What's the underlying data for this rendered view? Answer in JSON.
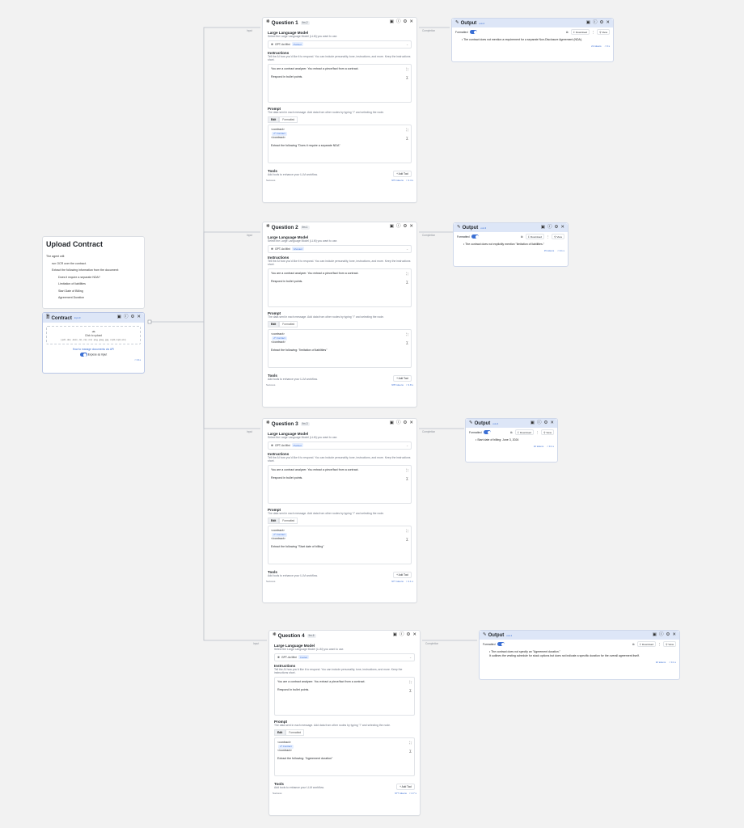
{
  "upload_card": {
    "title": "Upload Contract",
    "intro": "The agent will:",
    "steps": [
      "run OCR over the contract.",
      "Extract the following information from the document:"
    ],
    "sub_steps": [
      "Does it require a separate NDA?",
      "Limitation of liabilities",
      "Start Date of Billing",
      "Agreement Duration"
    ]
  },
  "contract_node": {
    "title": "Contract",
    "id": "inpt-0",
    "upload_label": "Click to upload",
    "file_types": "(.pdf, .doc, .docx, .txt, .csv, .md, .png, .jpeg, .jpg, .mp3, mp4, etc.)",
    "api_link": "How to manage documents via API",
    "expose_label": "Expose as input",
    "footer": "< 0.1s"
  },
  "questions": [
    {
      "title": "Question 1",
      "id": "llm-2",
      "model": "GPT-4o Mini",
      "model_tag": "Pushed",
      "instructions_line1": "You are a contract analyzer. You extract a piece/fact from a contract.",
      "instructions_line2": "Respond in bullet points.",
      "prompt_extract": "Extract the following \"Does it require a separate NDA\"",
      "status": "Success",
      "tokens": "973 tokens",
      "time": "< 4.4 s"
    },
    {
      "title": "Question 2",
      "id": "llm-1",
      "model": "GPT-4o Mini",
      "model_tag": "Ghosted",
      "instructions_line1": "You are a contract analyzer. You extract a piece/fact from a contract.",
      "instructions_line2": "Respond in bullet points.",
      "prompt_extract": "Extract the following: \"limitation of liabilities\"",
      "status": "Success",
      "tokens": "978 tokens",
      "time": "< 3.8 s"
    },
    {
      "title": "Question 3",
      "id": "llm-3",
      "model": "GPT-4o Mini",
      "model_tag": "Pushed",
      "instructions_line1": "You are a contract analyzer. You extract a piece/fact from a contract.",
      "instructions_line2": "Respond in bullet points.",
      "prompt_extract": "Extract the following \"Start date of billing\"",
      "status": "Success",
      "tokens": "977 tokens",
      "time": "< 4.1 s"
    },
    {
      "title": "Question 4",
      "id": "llm-6",
      "model": "GPT-4o Mini",
      "model_tag": "Cooled",
      "instructions_line1": "You are a contract analyzer. You extract a piece/fact from a contract.",
      "instructions_line2": "Respond in bullet points.",
      "prompt_extract": "Extract the following: \"Agreement duration\"",
      "status": "Success",
      "tokens": "977 tokens",
      "time": "< 4.7 s"
    }
  ],
  "llm_labels": {
    "model_title": "Large Language Model",
    "model_sub": "Select the Large Language Model (LLM) you want to use.",
    "instructions_title": "Instructions",
    "instructions_sub": "Tell the AI how you'd like it to respond. You can include personality, tone, instructions, and more. Keep the instructions short.",
    "prompt_title": "Prompt",
    "prompt_sub": "The data sent in each message. Add data from other nodes by typing \"/\" and selecting the node.",
    "tab_edit": "Edit",
    "tab_formatted": "Formatted",
    "contract_open": "<contract>",
    "contract_pill": "Contract",
    "contract_close": "</contract>",
    "tools_title": "Tools",
    "tools_sub": "Add tools to enhance your LLM workflow.",
    "add_tool": "+ Add Tool",
    "input_port": "Input",
    "completion_port": "Completion"
  },
  "outputs": [
    {
      "title": "Output",
      "id": "out-2",
      "formatted_label": "Formatted",
      "download": "Download",
      "view": "View",
      "lines": [
        "The contract does not mention a requirement for a separate Non-Disclosure Agreement (NDA)."
      ],
      "tokens": "21 tokens",
      "time": "< 0 s"
    },
    {
      "title": "Output",
      "id": "out-3",
      "formatted_label": "Formatted",
      "download": "Download",
      "view": "View",
      "lines": [
        "The contract does not explicitly mention \"limitation of liabilities.\""
      ],
      "tokens": "15 tokens",
      "time": "< 0.1 s"
    },
    {
      "title": "Output",
      "id": "out-4",
      "formatted_label": "Formatted",
      "download": "Download",
      "view": "View",
      "lines": [
        "Start date of billing: June 3, 2024"
      ],
      "tokens": "10 tokens",
      "time": "< 0.1 s"
    },
    {
      "title": "Output",
      "id": "out-1",
      "formatted_label": "Formatted",
      "download": "Download",
      "view": "View",
      "lines": [
        "The contract does not specify an \"Agreement duration.\"",
        "It outlines the vesting schedule for stock options but does not indicate a specific duration for the overall agreement itself."
      ],
      "tokens": "32 tokens",
      "time": "< 0.1 s"
    }
  ]
}
